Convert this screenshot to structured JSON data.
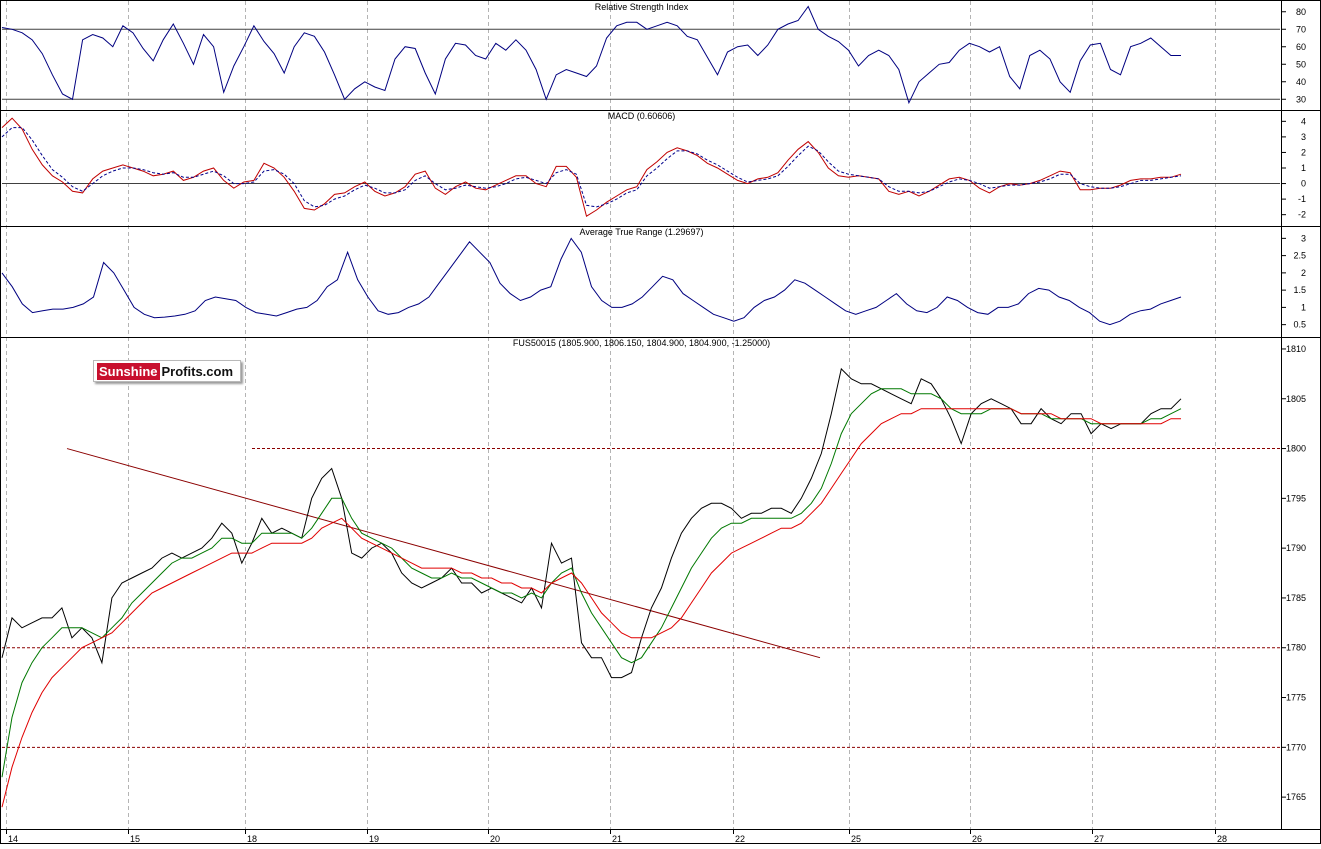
{
  "brand": {
    "part1": "Sunshine",
    "part2": "Profits.com",
    "red": "#c8102e"
  },
  "x_tick_labels": [
    "14",
    "15",
    "18",
    "19",
    "20",
    "21",
    "22",
    "25",
    "26",
    "27",
    "28"
  ],
  "colors": {
    "frame": "#000000",
    "grid": "#b4b4b4",
    "series_blue": "#000080",
    "price": "#000000",
    "ma_short": "#007800",
    "ma_long": "#e00000",
    "trend": "#8b0000",
    "support": "#8b0000",
    "signal": "#00008b"
  },
  "chart_data": [
    {
      "type": "line",
      "title": "Relative Strength Index",
      "ylim": [
        25,
        85
      ],
      "yticks": [
        30,
        40,
        50,
        60,
        70,
        80
      ],
      "levels": [
        30,
        70
      ],
      "series": [
        {
          "values": [
            71,
            70,
            68,
            64,
            56,
            44,
            33,
            30,
            64,
            67,
            65,
            60,
            72,
            68,
            59,
            52,
            64,
            73,
            62,
            50,
            67,
            60,
            34,
            49,
            60,
            72,
            63,
            56,
            45,
            60,
            68,
            66,
            57,
            44,
            30,
            36,
            40,
            37,
            35,
            53,
            60,
            59,
            45,
            33,
            53,
            62,
            61,
            55,
            53,
            62,
            58,
            64,
            58,
            47,
            30,
            44,
            47,
            45,
            43,
            49,
            65,
            72,
            74,
            74,
            70,
            72,
            74,
            72,
            66,
            64,
            54,
            44,
            57,
            60,
            61,
            55,
            61,
            70,
            73,
            75,
            83,
            70,
            66,
            63,
            58,
            49,
            55,
            58,
            55,
            47,
            28,
            40,
            45,
            50,
            51,
            58,
            62,
            60,
            57,
            60,
            43,
            36,
            55,
            58,
            53,
            40,
            34,
            52,
            61,
            62,
            47,
            44,
            60,
            62,
            65,
            60,
            55,
            55
          ]
        }
      ]
    },
    {
      "type": "line",
      "title": "MACD (0.60606)",
      "ylim": [
        -2.6,
        4.6
      ],
      "yticks": [
        -2,
        -1,
        0,
        1,
        2,
        3,
        4
      ],
      "levels": [
        0
      ],
      "series": [
        {
          "values": [
            3.6,
            4.2,
            3.5,
            2.2,
            1.2,
            0.5,
            0.1,
            -0.5,
            -0.6,
            0.3,
            0.8,
            1.0,
            1.2,
            1.0,
            0.8,
            0.5,
            0.6,
            0.8,
            0.2,
            0.4,
            0.8,
            1.0,
            0.2,
            -0.3,
            0.1,
            0.2,
            1.3,
            1.0,
            0.4,
            -0.5,
            -1.6,
            -1.7,
            -1.3,
            -0.7,
            -0.6,
            -0.2,
            0.1,
            -0.5,
            -0.8,
            -0.6,
            -0.2,
            0.6,
            0.8,
            -0.3,
            -0.7,
            -0.2,
            0.1,
            -0.3,
            -0.4,
            -0.1,
            0.2,
            0.5,
            0.5,
            0.0,
            -0.2,
            1.1,
            1.1,
            0.4,
            -2.1,
            -1.7,
            -1.2,
            -0.8,
            -0.4,
            -0.2,
            0.9,
            1.4,
            2.0,
            2.3,
            2.1,
            1.8,
            1.3,
            1.0,
            0.6,
            0.2,
            0.0,
            0.3,
            0.4,
            0.7,
            1.5,
            2.2,
            2.7,
            2.0,
            1.0,
            0.5,
            0.4,
            0.5,
            0.4,
            0.3,
            -0.5,
            -0.7,
            -0.5,
            -0.8,
            -0.5,
            -0.1,
            0.3,
            0.4,
            0.2,
            -0.3,
            -0.6,
            -0.2,
            0.0,
            -0.1,
            0.0,
            0.2,
            0.5,
            0.8,
            0.7,
            -0.4,
            -0.4,
            -0.3,
            -0.3,
            -0.1,
            0.2,
            0.3,
            0.3,
            0.4,
            0.4,
            0.6
          ]
        },
        {
          "values": [
            3.0,
            3.6,
            3.6,
            2.8,
            1.8,
            0.9,
            0.4,
            -0.2,
            -0.5,
            0.0,
            0.5,
            0.8,
            1.0,
            1.0,
            0.9,
            0.7,
            0.6,
            0.7,
            0.4,
            0.4,
            0.6,
            0.8,
            0.5,
            0.0,
            0.0,
            0.1,
            0.8,
            0.9,
            0.6,
            0.0,
            -1.1,
            -1.5,
            -1.4,
            -1.0,
            -0.8,
            -0.4,
            -0.1,
            -0.3,
            -0.6,
            -0.6,
            -0.4,
            0.2,
            0.5,
            0.0,
            -0.4,
            -0.3,
            -0.1,
            -0.2,
            -0.3,
            -0.2,
            0.0,
            0.3,
            0.4,
            0.2,
            0.0,
            0.7,
            0.9,
            0.6,
            -1.4,
            -1.5,
            -1.3,
            -1.0,
            -0.6,
            -0.4,
            0.5,
            1.0,
            1.6,
            2.1,
            2.1,
            1.9,
            1.5,
            1.2,
            0.8,
            0.4,
            0.1,
            0.2,
            0.3,
            0.5,
            1.1,
            1.8,
            2.4,
            2.1,
            1.4,
            0.8,
            0.6,
            0.5,
            0.4,
            0.3,
            -0.2,
            -0.5,
            -0.5,
            -0.6,
            -0.5,
            -0.2,
            0.1,
            0.3,
            0.2,
            0.0,
            -0.3,
            -0.2,
            -0.1,
            -0.1,
            0.0,
            0.1,
            0.3,
            0.6,
            0.6,
            0.0,
            -0.2,
            -0.3,
            -0.3,
            -0.2,
            0.0,
            0.2,
            0.2,
            0.3,
            0.4,
            0.5
          ]
        }
      ]
    },
    {
      "type": "line",
      "title": "Average True Range (1.29697)",
      "ylim": [
        0.2,
        3.3
      ],
      "yticks": [
        0.5,
        1.0,
        1.5,
        2.0,
        2.5,
        3.0
      ],
      "series": [
        {
          "values": [
            2.0,
            1.6,
            1.1,
            0.85,
            0.9,
            0.95,
            0.95,
            1.0,
            1.1,
            1.3,
            2.3,
            2.0,
            1.5,
            1.0,
            0.8,
            0.7,
            0.72,
            0.75,
            0.8,
            0.9,
            1.2,
            1.3,
            1.25,
            1.2,
            1.0,
            0.85,
            0.8,
            0.75,
            0.85,
            0.95,
            1.0,
            1.2,
            1.6,
            1.8,
            2.6,
            1.8,
            1.3,
            0.9,
            0.8,
            0.85,
            1.0,
            1.1,
            1.3,
            1.7,
            2.1,
            2.5,
            2.9,
            2.6,
            2.3,
            1.7,
            1.4,
            1.2,
            1.3,
            1.5,
            1.6,
            2.4,
            3.0,
            2.6,
            1.6,
            1.2,
            1.0,
            1.0,
            1.1,
            1.3,
            1.6,
            1.9,
            1.8,
            1.4,
            1.2,
            1.0,
            0.8,
            0.7,
            0.6,
            0.7,
            1.0,
            1.2,
            1.3,
            1.5,
            1.8,
            1.7,
            1.5,
            1.3,
            1.1,
            0.9,
            0.8,
            0.9,
            1.0,
            1.2,
            1.4,
            1.1,
            0.9,
            0.85,
            1.0,
            1.3,
            1.2,
            1.0,
            0.85,
            0.8,
            1.0,
            1.0,
            1.1,
            1.4,
            1.55,
            1.5,
            1.3,
            1.2,
            1.0,
            0.85,
            0.6,
            0.5,
            0.6,
            0.8,
            0.9,
            0.95,
            1.1,
            1.2,
            1.3
          ]
        }
      ]
    },
    {
      "type": "line",
      "title": "FUS50015 (1805.900, 1806.150, 1804.900, 1804.900, -1.25000)",
      "ylim": [
        1762,
        1811
      ],
      "yticks": [
        1765,
        1770,
        1775,
        1780,
        1785,
        1790,
        1795,
        1800,
        1805,
        1810
      ],
      "levels": [
        1770,
        1780,
        1800
      ],
      "trendline": [
        [
          0.5,
          1800
        ],
        [
          6.75,
          1779
        ]
      ],
      "series": [
        {
          "values": [
            1779.0,
            1783.0,
            1782.0,
            1782.5,
            1783.0,
            1783.0,
            1784.0,
            1781.0,
            1782.0,
            1781.0,
            1778.5,
            1785.0,
            1786.5,
            1787.0,
            1787.5,
            1788.0,
            1789.0,
            1789.5,
            1789.0,
            1789.5,
            1790.0,
            1791.0,
            1792.5,
            1791.5,
            1788.5,
            1790.5,
            1793.0,
            1791.5,
            1792.0,
            1791.5,
            1791.0,
            1795.0,
            1797.0,
            1798.0,
            1795.0,
            1789.5,
            1789.0,
            1790.0,
            1790.5,
            1789.5,
            1787.5,
            1786.5,
            1786.0,
            1786.5,
            1787.0,
            1788.0,
            1786.5,
            1786.5,
            1785.5,
            1786.0,
            1785.5,
            1785.0,
            1784.5,
            1786.0,
            1784.0,
            1790.5,
            1788.5,
            1789.0,
            1780.5,
            1779.0,
            1779.0,
            1777.0,
            1777.0,
            1777.5,
            1781.0,
            1784.0,
            1786.0,
            1789.0,
            1791.5,
            1793.0,
            1794.0,
            1794.5,
            1794.5,
            1794.0,
            1793.0,
            1793.5,
            1793.5,
            1794.0,
            1794.0,
            1793.5,
            1795.0,
            1797.0,
            1799.5,
            1803.5,
            1808.0,
            1807.0,
            1806.5,
            1806.5,
            1806.0,
            1805.5,
            1805.0,
            1804.5,
            1807.0,
            1806.5,
            1805.0,
            1803.0,
            1800.5,
            1803.5,
            1804.5,
            1805.0,
            1804.5,
            1804.0,
            1802.5,
            1802.5,
            1804.0,
            1803.0,
            1802.5,
            1803.5,
            1803.5,
            1801.5,
            1802.5,
            1802.0,
            1802.5,
            1802.5,
            1802.5,
            1803.5,
            1804.0,
            1804.0,
            1805.0
          ]
        },
        {
          "values": [
            1767.0,
            1773.0,
            1776.5,
            1778.5,
            1780.0,
            1781.0,
            1782.0,
            1782.0,
            1782.0,
            1781.5,
            1781.0,
            1782.0,
            1783.0,
            1784.5,
            1785.5,
            1786.5,
            1787.5,
            1788.5,
            1789.0,
            1789.0,
            1789.5,
            1790.0,
            1791.0,
            1791.0,
            1790.5,
            1790.5,
            1791.5,
            1791.5,
            1791.5,
            1791.5,
            1791.0,
            1792.0,
            1793.5,
            1795.0,
            1795.0,
            1793.0,
            1791.5,
            1791.0,
            1790.5,
            1790.0,
            1789.0,
            1788.0,
            1787.5,
            1787.0,
            1787.0,
            1787.5,
            1787.0,
            1787.0,
            1786.5,
            1786.0,
            1785.5,
            1785.5,
            1785.0,
            1785.5,
            1785.0,
            1786.5,
            1787.5,
            1788.0,
            1785.5,
            1783.5,
            1782.0,
            1780.5,
            1779.0,
            1778.5,
            1779.0,
            1780.5,
            1782.0,
            1784.0,
            1786.0,
            1788.0,
            1789.5,
            1791.0,
            1792.0,
            1792.5,
            1792.5,
            1793.0,
            1793.0,
            1793.0,
            1793.0,
            1793.0,
            1793.5,
            1794.5,
            1796.0,
            1798.5,
            1801.5,
            1803.5,
            1804.5,
            1805.5,
            1806.0,
            1806.0,
            1806.0,
            1805.5,
            1805.5,
            1805.5,
            1805.0,
            1804.0,
            1803.5,
            1803.5,
            1803.5,
            1804.0,
            1804.0,
            1804.0,
            1803.5,
            1803.5,
            1803.5,
            1803.0,
            1803.0,
            1803.0,
            1803.0,
            1802.5,
            1802.5,
            1802.5,
            1802.5,
            1802.5,
            1802.5,
            1803.0,
            1803.0,
            1803.5,
            1804.0
          ]
        },
        {
          "values": [
            1764.0,
            1768.0,
            1771.0,
            1773.5,
            1775.5,
            1777.0,
            1778.0,
            1779.0,
            1780.0,
            1780.5,
            1781.0,
            1781.5,
            1782.5,
            1783.5,
            1784.5,
            1785.5,
            1786.0,
            1786.5,
            1787.0,
            1787.5,
            1788.0,
            1788.5,
            1789.0,
            1789.5,
            1789.5,
            1789.5,
            1790.0,
            1790.5,
            1790.5,
            1790.5,
            1790.5,
            1791.0,
            1792.0,
            1792.5,
            1793.0,
            1792.0,
            1791.0,
            1790.5,
            1790.0,
            1789.5,
            1789.0,
            1788.5,
            1788.0,
            1788.0,
            1788.0,
            1788.0,
            1787.5,
            1787.5,
            1787.0,
            1787.0,
            1786.5,
            1786.5,
            1786.0,
            1786.0,
            1785.5,
            1786.5,
            1787.0,
            1787.5,
            1786.5,
            1785.0,
            1783.5,
            1782.5,
            1781.5,
            1781.0,
            1781.0,
            1781.0,
            1781.5,
            1782.0,
            1783.0,
            1784.5,
            1786.0,
            1787.5,
            1788.5,
            1789.5,
            1790.0,
            1790.5,
            1791.0,
            1791.5,
            1792.0,
            1792.0,
            1792.5,
            1793.5,
            1794.5,
            1796.0,
            1797.5,
            1799.0,
            1800.5,
            1801.5,
            1802.5,
            1803.0,
            1803.5,
            1803.5,
            1804.0,
            1804.0,
            1804.0,
            1804.0,
            1804.0,
            1804.0,
            1804.0,
            1804.0,
            1804.0,
            1804.0,
            1803.5,
            1803.5,
            1803.5,
            1803.5,
            1803.0,
            1803.0,
            1803.0,
            1803.0,
            1802.5,
            1802.5,
            1802.5,
            1802.5,
            1802.5,
            1802.5,
            1802.5,
            1803.0,
            1803.0
          ]
        }
      ]
    }
  ]
}
